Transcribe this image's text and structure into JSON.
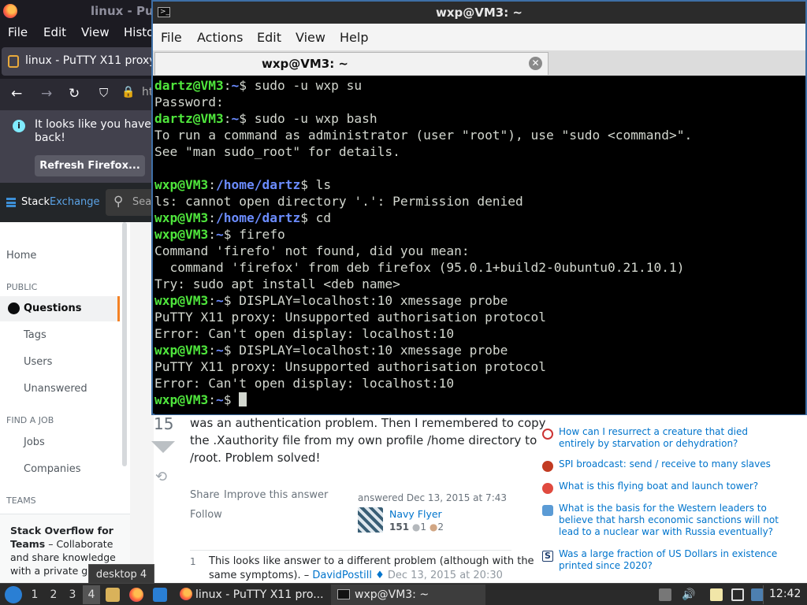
{
  "firefox": {
    "window_title": "linux - Pu",
    "menu": [
      "File",
      "Edit",
      "View",
      "Histo"
    ],
    "tab_label": "linux - PuTTY X11 proxy:",
    "url_fragment": "ht",
    "notice_text": "It looks like you haven't started Firefox in a while. Do you want to clean it up for a fresh, like-new experience? And by the way, welcome back!",
    "notice_visible_line1": "It looks like you haven",
    "notice_visible_line2": "back!",
    "refresh_button": "Refresh Firefox..."
  },
  "stackexchange": {
    "brand_a": "Stack",
    "brand_b": "Exchange",
    "search_placeholder": "Sea",
    "sidebar": {
      "home": "Home",
      "public_heading": "PUBLIC",
      "questions": "Questions",
      "tags": "Tags",
      "users": "Users",
      "unanswered": "Unanswered",
      "find_job_heading": "FIND A JOB",
      "jobs": "Jobs",
      "companies": "Companies",
      "teams_heading": "TEAMS",
      "teams_promo_bold": "Stack Overflow for Teams",
      "teams_promo_rest": " – Collaborate and share knowledge with a private gro"
    },
    "answer": {
      "vote_count": "15",
      "text_line1": "was an authentication problem. Then I remembered to copy",
      "text_line2": "the .Xauthority file from my own profile /home directory to",
      "text_line3": "/root. Problem solved!",
      "share": "Share",
      "improve": "Improve this answer",
      "follow": "Follow",
      "answered": "answered Dec 13, 2015 at 7:43",
      "author": "Navy Flyer",
      "rep": "151",
      "silver": "1",
      "bronze": "2",
      "comment_votes": "1",
      "comment_line1": "This looks like answer to a different problem (although with the",
      "comment_line2": "same symptoms). –",
      "comment_author": "DavidPostill",
      "comment_date": "Dec 13, 2015 at 20:30"
    },
    "hot_questions": [
      "How can I resurrect a creature that died entirely by starvation or dehydration?",
      "SPI broadcast: send / receive to many slaves",
      "What is this flying boat and launch tower?",
      "What is the basis for the Western leaders to believe that harsh economic sanctions will not lead to a nuclear war with Russia eventually?",
      "Was a large fraction of US Dollars in existence printed since 2020?"
    ]
  },
  "terminal": {
    "window_title": "wxp@VM3: ~",
    "menu": [
      "File",
      "Actions",
      "Edit",
      "View",
      "Help"
    ],
    "tab_title": "wxp@VM3: ~",
    "lines": [
      {
        "ug": "dartz@VM3",
        "path": "~",
        "cmd": " sudo -u wxp su"
      },
      {
        "text": "Password:"
      },
      {
        "ug": "dartz@VM3",
        "path": "~",
        "cmd": " sudo -u wxp bash"
      },
      {
        "text": "To run a command as administrator (user \"root\"), use \"sudo <command>\"."
      },
      {
        "text": "See \"man sudo_root\" for details."
      },
      {
        "text": ""
      },
      {
        "ug": "wxp@VM3",
        "path": "/home/dartz",
        "cmd": " ls"
      },
      {
        "text": "ls: cannot open directory '.': Permission denied"
      },
      {
        "ug": "wxp@VM3",
        "path": "/home/dartz",
        "cmd": " cd"
      },
      {
        "ug": "wxp@VM3",
        "path": "~",
        "cmd": " firefo"
      },
      {
        "text": "Command 'firefo' not found, did you mean:"
      },
      {
        "text": "  command 'firefox' from deb firefox (95.0.1+build2-0ubuntu0.21.10.1)"
      },
      {
        "text": "Try: sudo apt install <deb name>"
      },
      {
        "ug": "wxp@VM3",
        "path": "~",
        "cmd": " DISPLAY=localhost:10 xmessage probe"
      },
      {
        "text": "PuTTY X11 proxy: Unsupported authorisation protocol"
      },
      {
        "text": "Error: Can't open display: localhost:10"
      },
      {
        "ug": "wxp@VM3",
        "path": "~",
        "cmd": " DISPLAY=localhost:10 xmessage probe"
      },
      {
        "text": "PuTTY X11 proxy: Unsupported authorisation protocol"
      },
      {
        "text": "Error: Can't open display: localhost:10"
      },
      {
        "ug": "wxp@VM3",
        "path": "~",
        "cmd": " ",
        "cursor": true
      }
    ]
  },
  "taskbar": {
    "workspaces": [
      "1",
      "2",
      "3",
      "4"
    ],
    "active_workspace": "4",
    "workspace_tooltip": "desktop 4",
    "tasks": [
      "linux - PuTTY X11 pro...",
      "wxp@VM3: ~"
    ],
    "clock": "12:42"
  },
  "colors": {
    "prompt_green": "#4fe63c",
    "prompt_path_blue": "#6b8cff",
    "terminal_bg": "#000000",
    "link_blue": "#0074cc",
    "accent_orange": "#f48225"
  }
}
